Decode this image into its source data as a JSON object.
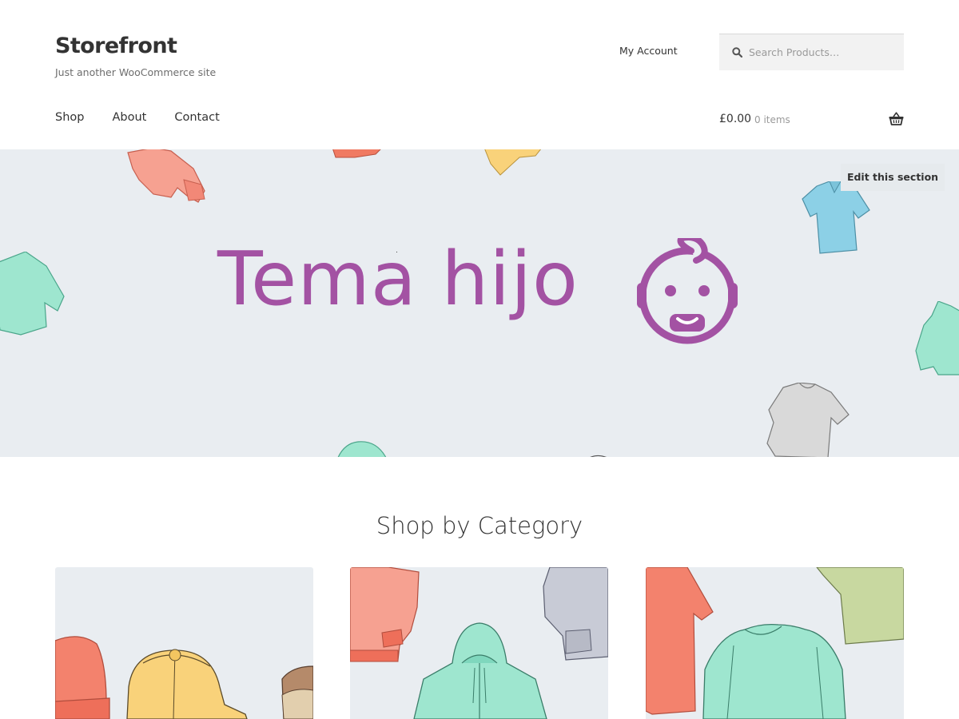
{
  "header": {
    "site_title": "Storefront",
    "tagline": "Just another WooCommerce site",
    "my_account": "My Account",
    "search": {
      "placeholder": "Search Products…",
      "value": ""
    },
    "nav": [
      {
        "label": "Shop"
      },
      {
        "label": "About"
      },
      {
        "label": "Contact"
      }
    ],
    "cart": {
      "amount": "£0.00",
      "count": "0 items"
    }
  },
  "hero": {
    "heading": "Tema hijo",
    "edit_button": "Edit this section",
    "heading_color": "#a352a3",
    "background_color": "#e9edf1"
  },
  "categories": {
    "title": "Shop by Category",
    "items": [
      {
        "image": "accessories-illustration"
      },
      {
        "image": "hoodies-illustration"
      },
      {
        "image": "tshirts-illustration"
      }
    ]
  },
  "icons": {
    "search": "search-icon",
    "cart": "basket-icon",
    "hero": "baby-face-icon"
  }
}
